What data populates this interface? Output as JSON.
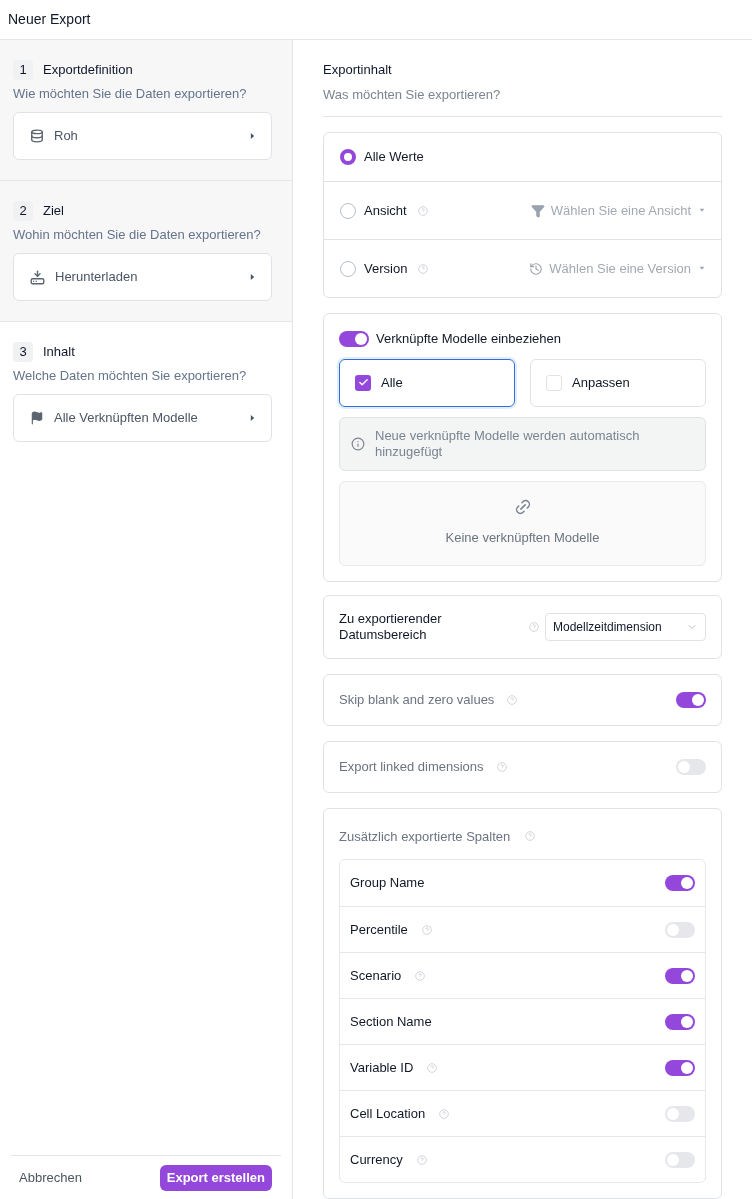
{
  "window": {
    "title": "Neuer Export"
  },
  "steps": [
    {
      "number": "1",
      "title": "Exportdefinition",
      "question": "Wie möchten Sie die Daten exportieren?",
      "value": "Roh",
      "kind": "database",
      "highlighted": true
    },
    {
      "number": "2",
      "title": "Ziel",
      "question": "Wohin möchten Sie die Daten exportieren?",
      "value": "Herunterladen",
      "kind": "download",
      "highlighted": true
    },
    {
      "number": "3",
      "title": "Inhalt",
      "question": "Welche Daten möchten Sie exportieren?",
      "value": "Alle Verknüpften Modelle",
      "kind": "flag",
      "highlighted": false
    }
  ],
  "footer": {
    "cancel": "Abbrechen",
    "submit": "Export erstellen"
  },
  "content": {
    "title": "Exportinhalt",
    "subtitle": "Was möchten Sie exportieren?",
    "scope_options": [
      {
        "label": "Alle Werte",
        "selected": true,
        "help": false
      },
      {
        "label": "Ansicht",
        "selected": false,
        "help": true,
        "kind": "view",
        "placeholder": "Wählen Sie eine Ansicht"
      },
      {
        "label": "Version",
        "selected": false,
        "help": true,
        "kind": "version",
        "placeholder": "Wählen Sie eine Version"
      }
    ],
    "linked_models": {
      "label": "Verknüpfte Modelle einbeziehen",
      "on": true,
      "choices": [
        {
          "label": "Alle",
          "selected": true
        },
        {
          "label": "Anpassen",
          "selected": false
        }
      ],
      "info": "Neue verknüpfte Modelle werden automatisch hinzugefügt",
      "empty": "Keine verknüpften Modelle"
    },
    "date_range": {
      "label": "Zu exportierender Datumsbereich",
      "help": true,
      "value": "Modellzeitdimension"
    },
    "settings": [
      {
        "label": "Skip blank and zero values",
        "help": true,
        "on": true
      },
      {
        "label": "Export linked dimensions",
        "help": true,
        "on": false
      }
    ],
    "extra_columns": {
      "title": "Zusätzlich exportierte Spalten",
      "help": true,
      "items": [
        {
          "label": "Group Name",
          "help": false,
          "on": true
        },
        {
          "label": "Percentile",
          "help": true,
          "on": false
        },
        {
          "label": "Scenario",
          "help": true,
          "on": true
        },
        {
          "label": "Section Name",
          "help": false,
          "on": true
        },
        {
          "label": "Variable ID",
          "help": true,
          "on": true
        },
        {
          "label": "Cell Location",
          "help": true,
          "on": false
        },
        {
          "label": "Currency",
          "help": true,
          "on": false
        }
      ]
    }
  }
}
